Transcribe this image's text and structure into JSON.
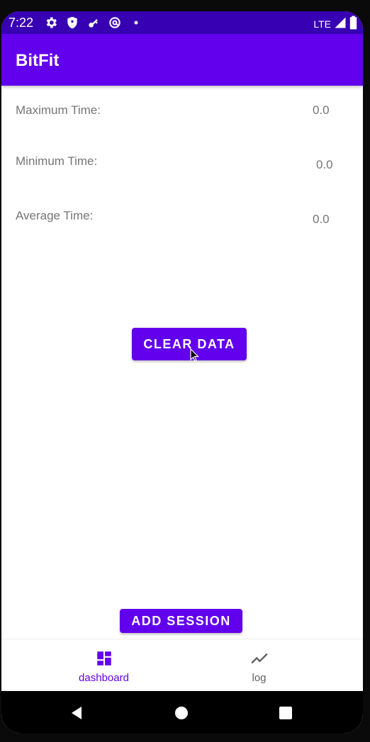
{
  "status_bar": {
    "time": "7:22",
    "network": "LTE",
    "icons": [
      "settings-icon",
      "shield-icon",
      "vpn-key-icon",
      "at-sign-icon",
      "dot-icon",
      "signal-icon",
      "battery-icon"
    ]
  },
  "app_bar": {
    "title": "BitFit"
  },
  "stats": [
    {
      "label": "Maximum Time:",
      "value": "0.0"
    },
    {
      "label": "Minimum Time:",
      "value": "0.0"
    },
    {
      "label": "Average Time:",
      "value": "0.0"
    }
  ],
  "buttons": {
    "clear_data": "CLEAR DATA",
    "add_session": "ADD SESSION"
  },
  "bottom_nav": {
    "items": [
      {
        "label": "dashboard",
        "icon": "dashboard-icon",
        "active": true
      },
      {
        "label": "log",
        "icon": "trending-line-icon",
        "active": false
      }
    ]
  },
  "colors": {
    "primary": "#6200EE",
    "primary_dark": "#3700B3",
    "text_secondary": "#757575",
    "nav_inactive": "#616161"
  }
}
